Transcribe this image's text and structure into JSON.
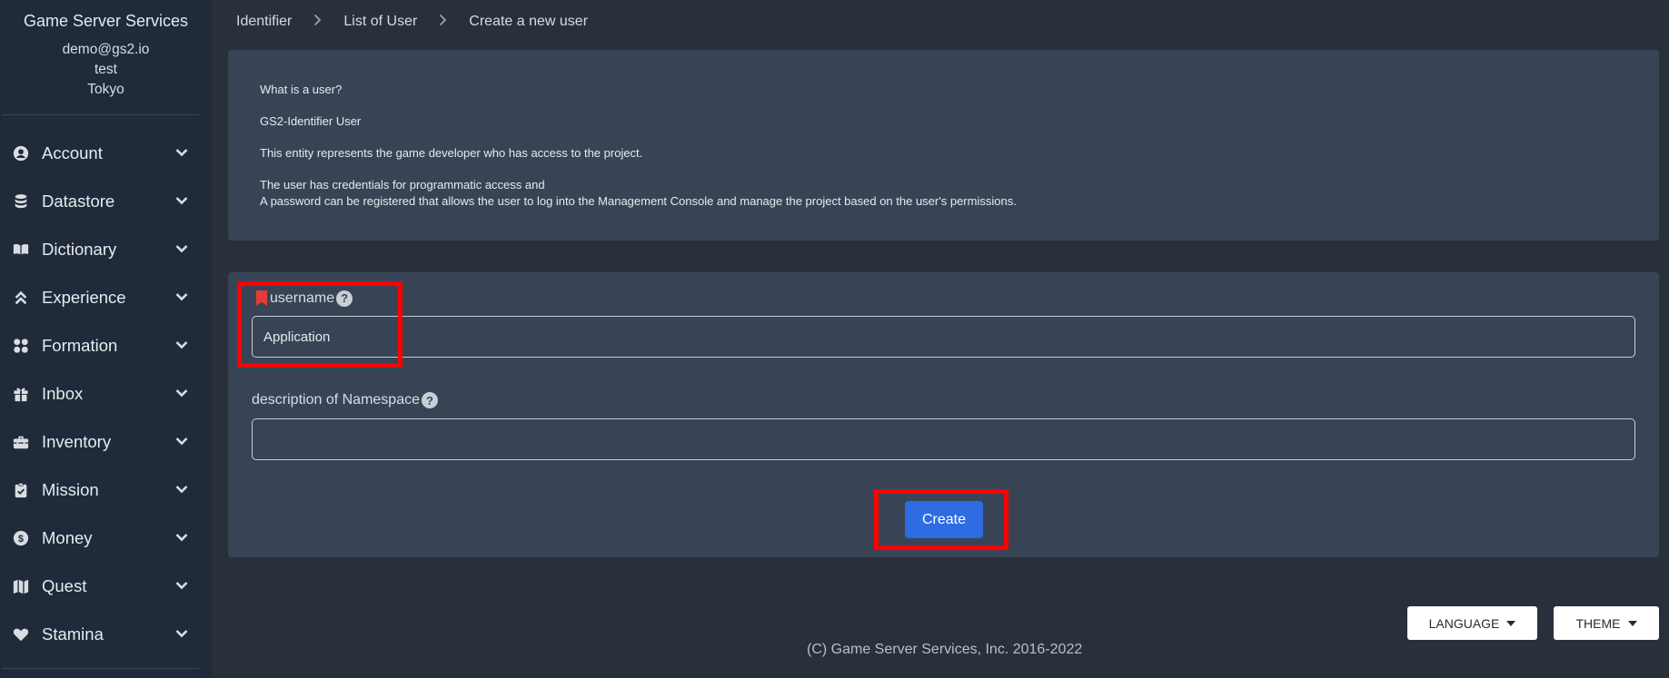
{
  "sidebar": {
    "brand": "Game Server Services",
    "user": {
      "email": "demo@gs2.io",
      "project": "test",
      "region": "Tokyo"
    },
    "items": [
      {
        "label": "Account",
        "icon": "user-circle-icon"
      },
      {
        "label": "Datastore",
        "icon": "database-icon"
      },
      {
        "label": "Dictionary",
        "icon": "book-open-icon"
      },
      {
        "label": "Experience",
        "icon": "angles-up-icon"
      },
      {
        "label": "Formation",
        "icon": "grid-icon"
      },
      {
        "label": "Inbox",
        "icon": "gift-icon"
      },
      {
        "label": "Inventory",
        "icon": "toolbox-icon"
      },
      {
        "label": "Mission",
        "icon": "clipboard-check-icon"
      },
      {
        "label": "Money",
        "icon": "coin-icon"
      },
      {
        "label": "Quest",
        "icon": "map-icon"
      },
      {
        "label": "Stamina",
        "icon": "heart-icon"
      }
    ]
  },
  "breadcrumb": [
    "Identifier",
    "List of User",
    "Create a new user"
  ],
  "info": {
    "heading": "What is a user?",
    "subheading": "GS2-Identifier User",
    "line1": "This entity represents the game developer who has access to the project.",
    "line2": "The user has credentials for programmatic access and",
    "line3": "A password can be registered that allows the user to log into the Management Console and manage the project based on the user's permissions."
  },
  "form": {
    "username_label": "username",
    "username_value": "Application",
    "description_label": "description of Namespace",
    "description_value": "",
    "create_label": "Create"
  },
  "footer": {
    "language_label": "LANGUAGE",
    "theme_label": "THEME",
    "copyright": "(C) Game Server Services, Inc. 2016-2022"
  },
  "colors": {
    "sidebar_bg": "#1f2b3a",
    "page_bg": "#2a303b",
    "panel_bg": "#384456",
    "primary": "#2f6be3",
    "required": "#e53a3a",
    "highlight": "#ff0000"
  }
}
